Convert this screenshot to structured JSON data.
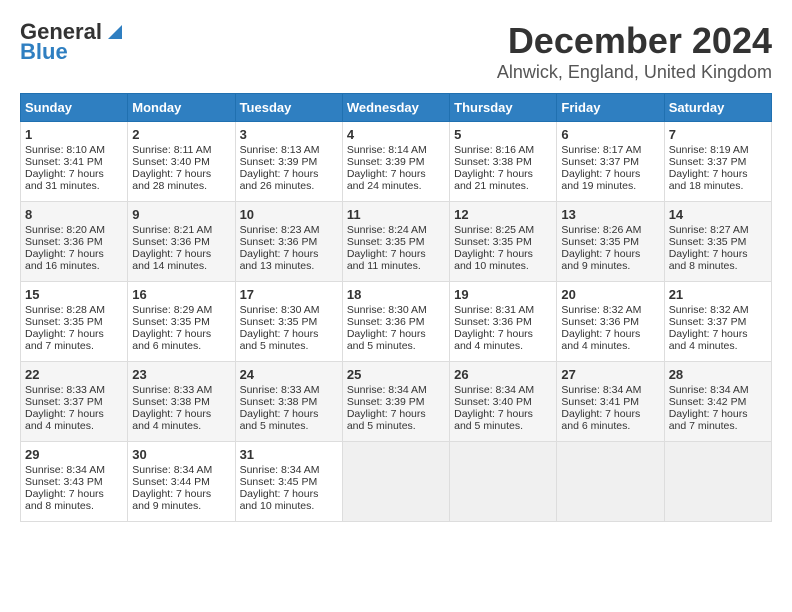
{
  "header": {
    "logo_line1": "General",
    "logo_line2": "Blue",
    "month": "December 2024",
    "location": "Alnwick, England, United Kingdom"
  },
  "days_of_week": [
    "Sunday",
    "Monday",
    "Tuesday",
    "Wednesday",
    "Thursday",
    "Friday",
    "Saturday"
  ],
  "weeks": [
    [
      {
        "day": "1",
        "info": "Sunrise: 8:10 AM\nSunset: 3:41 PM\nDaylight: 7 hours\nand 31 minutes."
      },
      {
        "day": "2",
        "info": "Sunrise: 8:11 AM\nSunset: 3:40 PM\nDaylight: 7 hours\nand 28 minutes."
      },
      {
        "day": "3",
        "info": "Sunrise: 8:13 AM\nSunset: 3:39 PM\nDaylight: 7 hours\nand 26 minutes."
      },
      {
        "day": "4",
        "info": "Sunrise: 8:14 AM\nSunset: 3:39 PM\nDaylight: 7 hours\nand 24 minutes."
      },
      {
        "day": "5",
        "info": "Sunrise: 8:16 AM\nSunset: 3:38 PM\nDaylight: 7 hours\nand 21 minutes."
      },
      {
        "day": "6",
        "info": "Sunrise: 8:17 AM\nSunset: 3:37 PM\nDaylight: 7 hours\nand 19 minutes."
      },
      {
        "day": "7",
        "info": "Sunrise: 8:19 AM\nSunset: 3:37 PM\nDaylight: 7 hours\nand 18 minutes."
      }
    ],
    [
      {
        "day": "8",
        "info": "Sunrise: 8:20 AM\nSunset: 3:36 PM\nDaylight: 7 hours\nand 16 minutes."
      },
      {
        "day": "9",
        "info": "Sunrise: 8:21 AM\nSunset: 3:36 PM\nDaylight: 7 hours\nand 14 minutes."
      },
      {
        "day": "10",
        "info": "Sunrise: 8:23 AM\nSunset: 3:36 PM\nDaylight: 7 hours\nand 13 minutes."
      },
      {
        "day": "11",
        "info": "Sunrise: 8:24 AM\nSunset: 3:35 PM\nDaylight: 7 hours\nand 11 minutes."
      },
      {
        "day": "12",
        "info": "Sunrise: 8:25 AM\nSunset: 3:35 PM\nDaylight: 7 hours\nand 10 minutes."
      },
      {
        "day": "13",
        "info": "Sunrise: 8:26 AM\nSunset: 3:35 PM\nDaylight: 7 hours\nand 9 minutes."
      },
      {
        "day": "14",
        "info": "Sunrise: 8:27 AM\nSunset: 3:35 PM\nDaylight: 7 hours\nand 8 minutes."
      }
    ],
    [
      {
        "day": "15",
        "info": "Sunrise: 8:28 AM\nSunset: 3:35 PM\nDaylight: 7 hours\nand 7 minutes."
      },
      {
        "day": "16",
        "info": "Sunrise: 8:29 AM\nSunset: 3:35 PM\nDaylight: 7 hours\nand 6 minutes."
      },
      {
        "day": "17",
        "info": "Sunrise: 8:30 AM\nSunset: 3:35 PM\nDaylight: 7 hours\nand 5 minutes."
      },
      {
        "day": "18",
        "info": "Sunrise: 8:30 AM\nSunset: 3:36 PM\nDaylight: 7 hours\nand 5 minutes."
      },
      {
        "day": "19",
        "info": "Sunrise: 8:31 AM\nSunset: 3:36 PM\nDaylight: 7 hours\nand 4 minutes."
      },
      {
        "day": "20",
        "info": "Sunrise: 8:32 AM\nSunset: 3:36 PM\nDaylight: 7 hours\nand 4 minutes."
      },
      {
        "day": "21",
        "info": "Sunrise: 8:32 AM\nSunset: 3:37 PM\nDaylight: 7 hours\nand 4 minutes."
      }
    ],
    [
      {
        "day": "22",
        "info": "Sunrise: 8:33 AM\nSunset: 3:37 PM\nDaylight: 7 hours\nand 4 minutes."
      },
      {
        "day": "23",
        "info": "Sunrise: 8:33 AM\nSunset: 3:38 PM\nDaylight: 7 hours\nand 4 minutes."
      },
      {
        "day": "24",
        "info": "Sunrise: 8:33 AM\nSunset: 3:38 PM\nDaylight: 7 hours\nand 5 minutes."
      },
      {
        "day": "25",
        "info": "Sunrise: 8:34 AM\nSunset: 3:39 PM\nDaylight: 7 hours\nand 5 minutes."
      },
      {
        "day": "26",
        "info": "Sunrise: 8:34 AM\nSunset: 3:40 PM\nDaylight: 7 hours\nand 5 minutes."
      },
      {
        "day": "27",
        "info": "Sunrise: 8:34 AM\nSunset: 3:41 PM\nDaylight: 7 hours\nand 6 minutes."
      },
      {
        "day": "28",
        "info": "Sunrise: 8:34 AM\nSunset: 3:42 PM\nDaylight: 7 hours\nand 7 minutes."
      }
    ],
    [
      {
        "day": "29",
        "info": "Sunrise: 8:34 AM\nSunset: 3:43 PM\nDaylight: 7 hours\nand 8 minutes."
      },
      {
        "day": "30",
        "info": "Sunrise: 8:34 AM\nSunset: 3:44 PM\nDaylight: 7 hours\nand 9 minutes."
      },
      {
        "day": "31",
        "info": "Sunrise: 8:34 AM\nSunset: 3:45 PM\nDaylight: 7 hours\nand 10 minutes."
      },
      {
        "day": "",
        "info": ""
      },
      {
        "day": "",
        "info": ""
      },
      {
        "day": "",
        "info": ""
      },
      {
        "day": "",
        "info": ""
      }
    ]
  ]
}
